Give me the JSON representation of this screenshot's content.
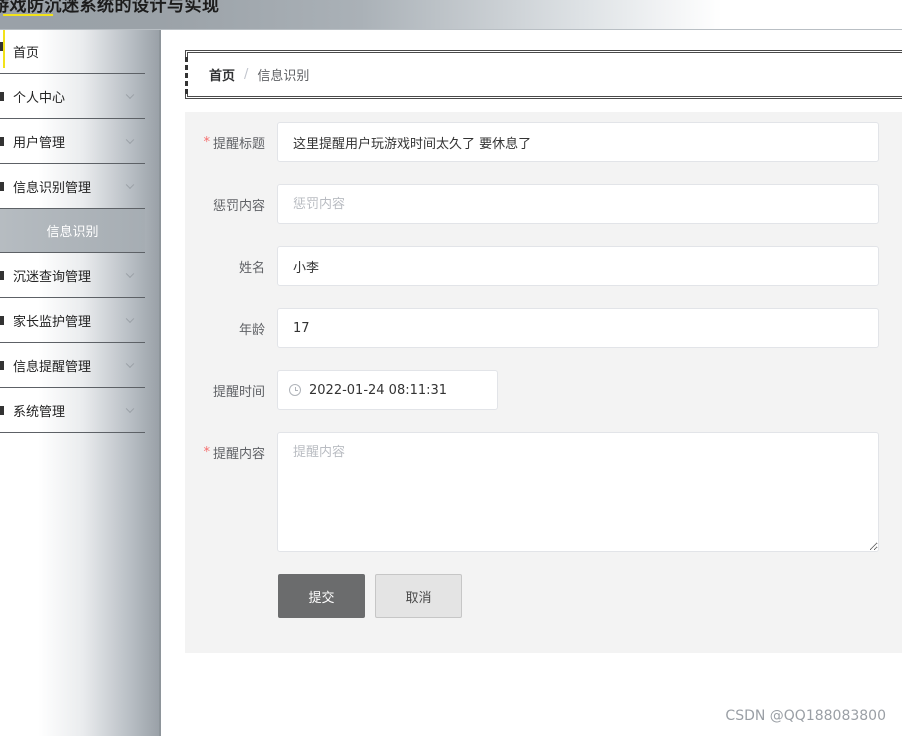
{
  "header": {
    "title": "游戏防沉迷系统的设计与实现"
  },
  "sidebar": {
    "items": [
      {
        "label": "首页"
      },
      {
        "label": "个人中心"
      },
      {
        "label": "用户管理"
      },
      {
        "label": "信息识别管理"
      },
      {
        "label": "信息识别"
      },
      {
        "label": "沉迷查询管理"
      },
      {
        "label": "家长监护管理"
      },
      {
        "label": "信息提醒管理"
      },
      {
        "label": "系统管理"
      }
    ]
  },
  "breadcrumb": {
    "home": "首页",
    "separator": "/",
    "current": "信息识别"
  },
  "form": {
    "title_label": "提醒标题",
    "title_value": "这里提醒用户玩游戏时间太久了 要休息了",
    "penalty_label": "惩罚内容",
    "penalty_placeholder": "惩罚内容",
    "name_label": "姓名",
    "name_value": "小李",
    "age_label": "年龄",
    "age_value": "17",
    "time_label": "提醒时间",
    "time_value": "2022-01-24 08:11:31",
    "content_label": "提醒内容",
    "content_placeholder": "提醒内容",
    "required_mark": "*",
    "submit_label": "提交",
    "cancel_label": "取消"
  },
  "watermark": "CSDN @QQ188083800",
  "colors": {
    "required": "#f56c6c",
    "submit_bg": "#6b6c6d",
    "panel_bg": "#f3f3f3"
  }
}
